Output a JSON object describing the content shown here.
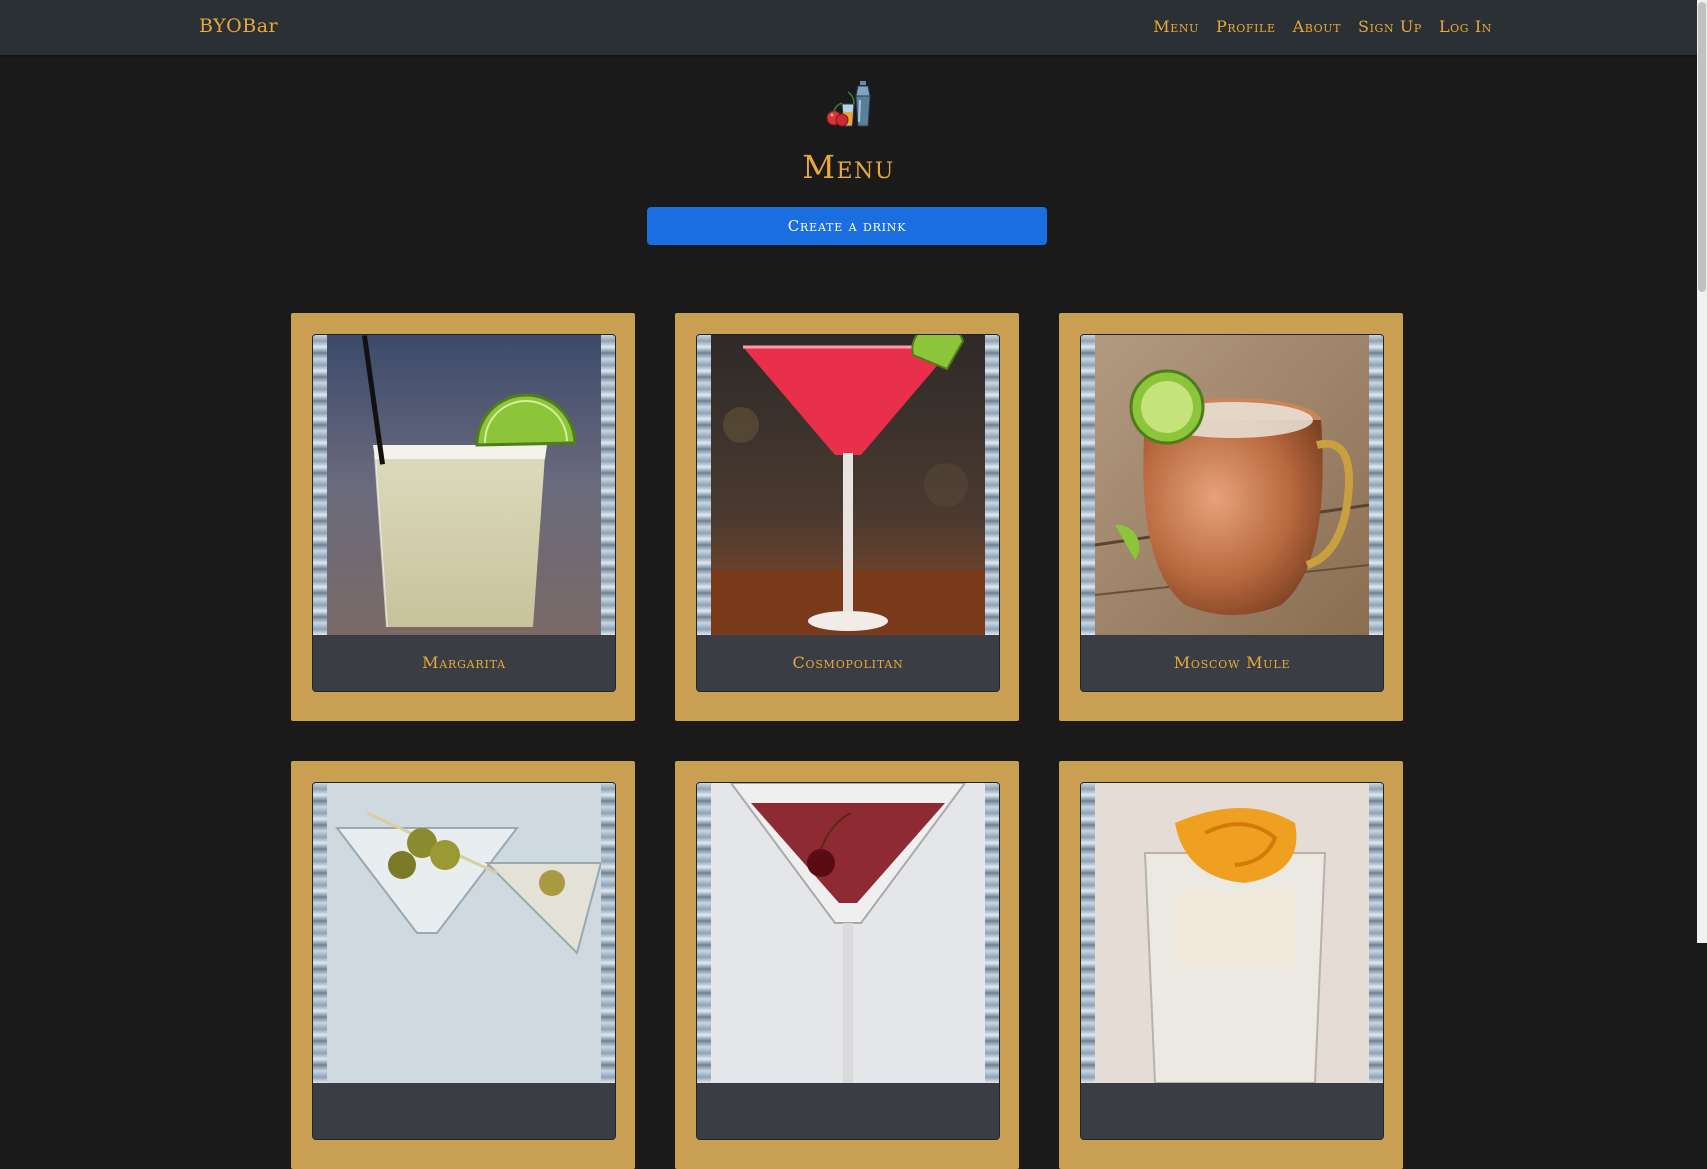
{
  "navbar": {
    "brand": "BYOBar",
    "links": [
      "Menu",
      "Profile",
      "About",
      "Sign Up",
      "Log In"
    ]
  },
  "logo_icon": "cocktail-shaker-icon",
  "page_title": "Menu",
  "create_button_label": "Create a drink",
  "drinks": [
    {
      "name": "Margarita",
      "image": "margarita-photo"
    },
    {
      "name": "Cosmopolitan",
      "image": "cosmopolitan-photo"
    },
    {
      "name": "Moscow Mule",
      "image": "moscow-mule-photo"
    },
    {
      "name": "",
      "image": "martini-photo"
    },
    {
      "name": "",
      "image": "manhattan-photo"
    },
    {
      "name": "",
      "image": "old-fashioned-photo"
    }
  ],
  "colors": {
    "background": "#1a1a1b",
    "navbar": "#2b3035",
    "accent_gold": "#e8a93a",
    "card": "#c9a052",
    "card_label": "#3b3d44",
    "button": "#1b6ee0"
  }
}
